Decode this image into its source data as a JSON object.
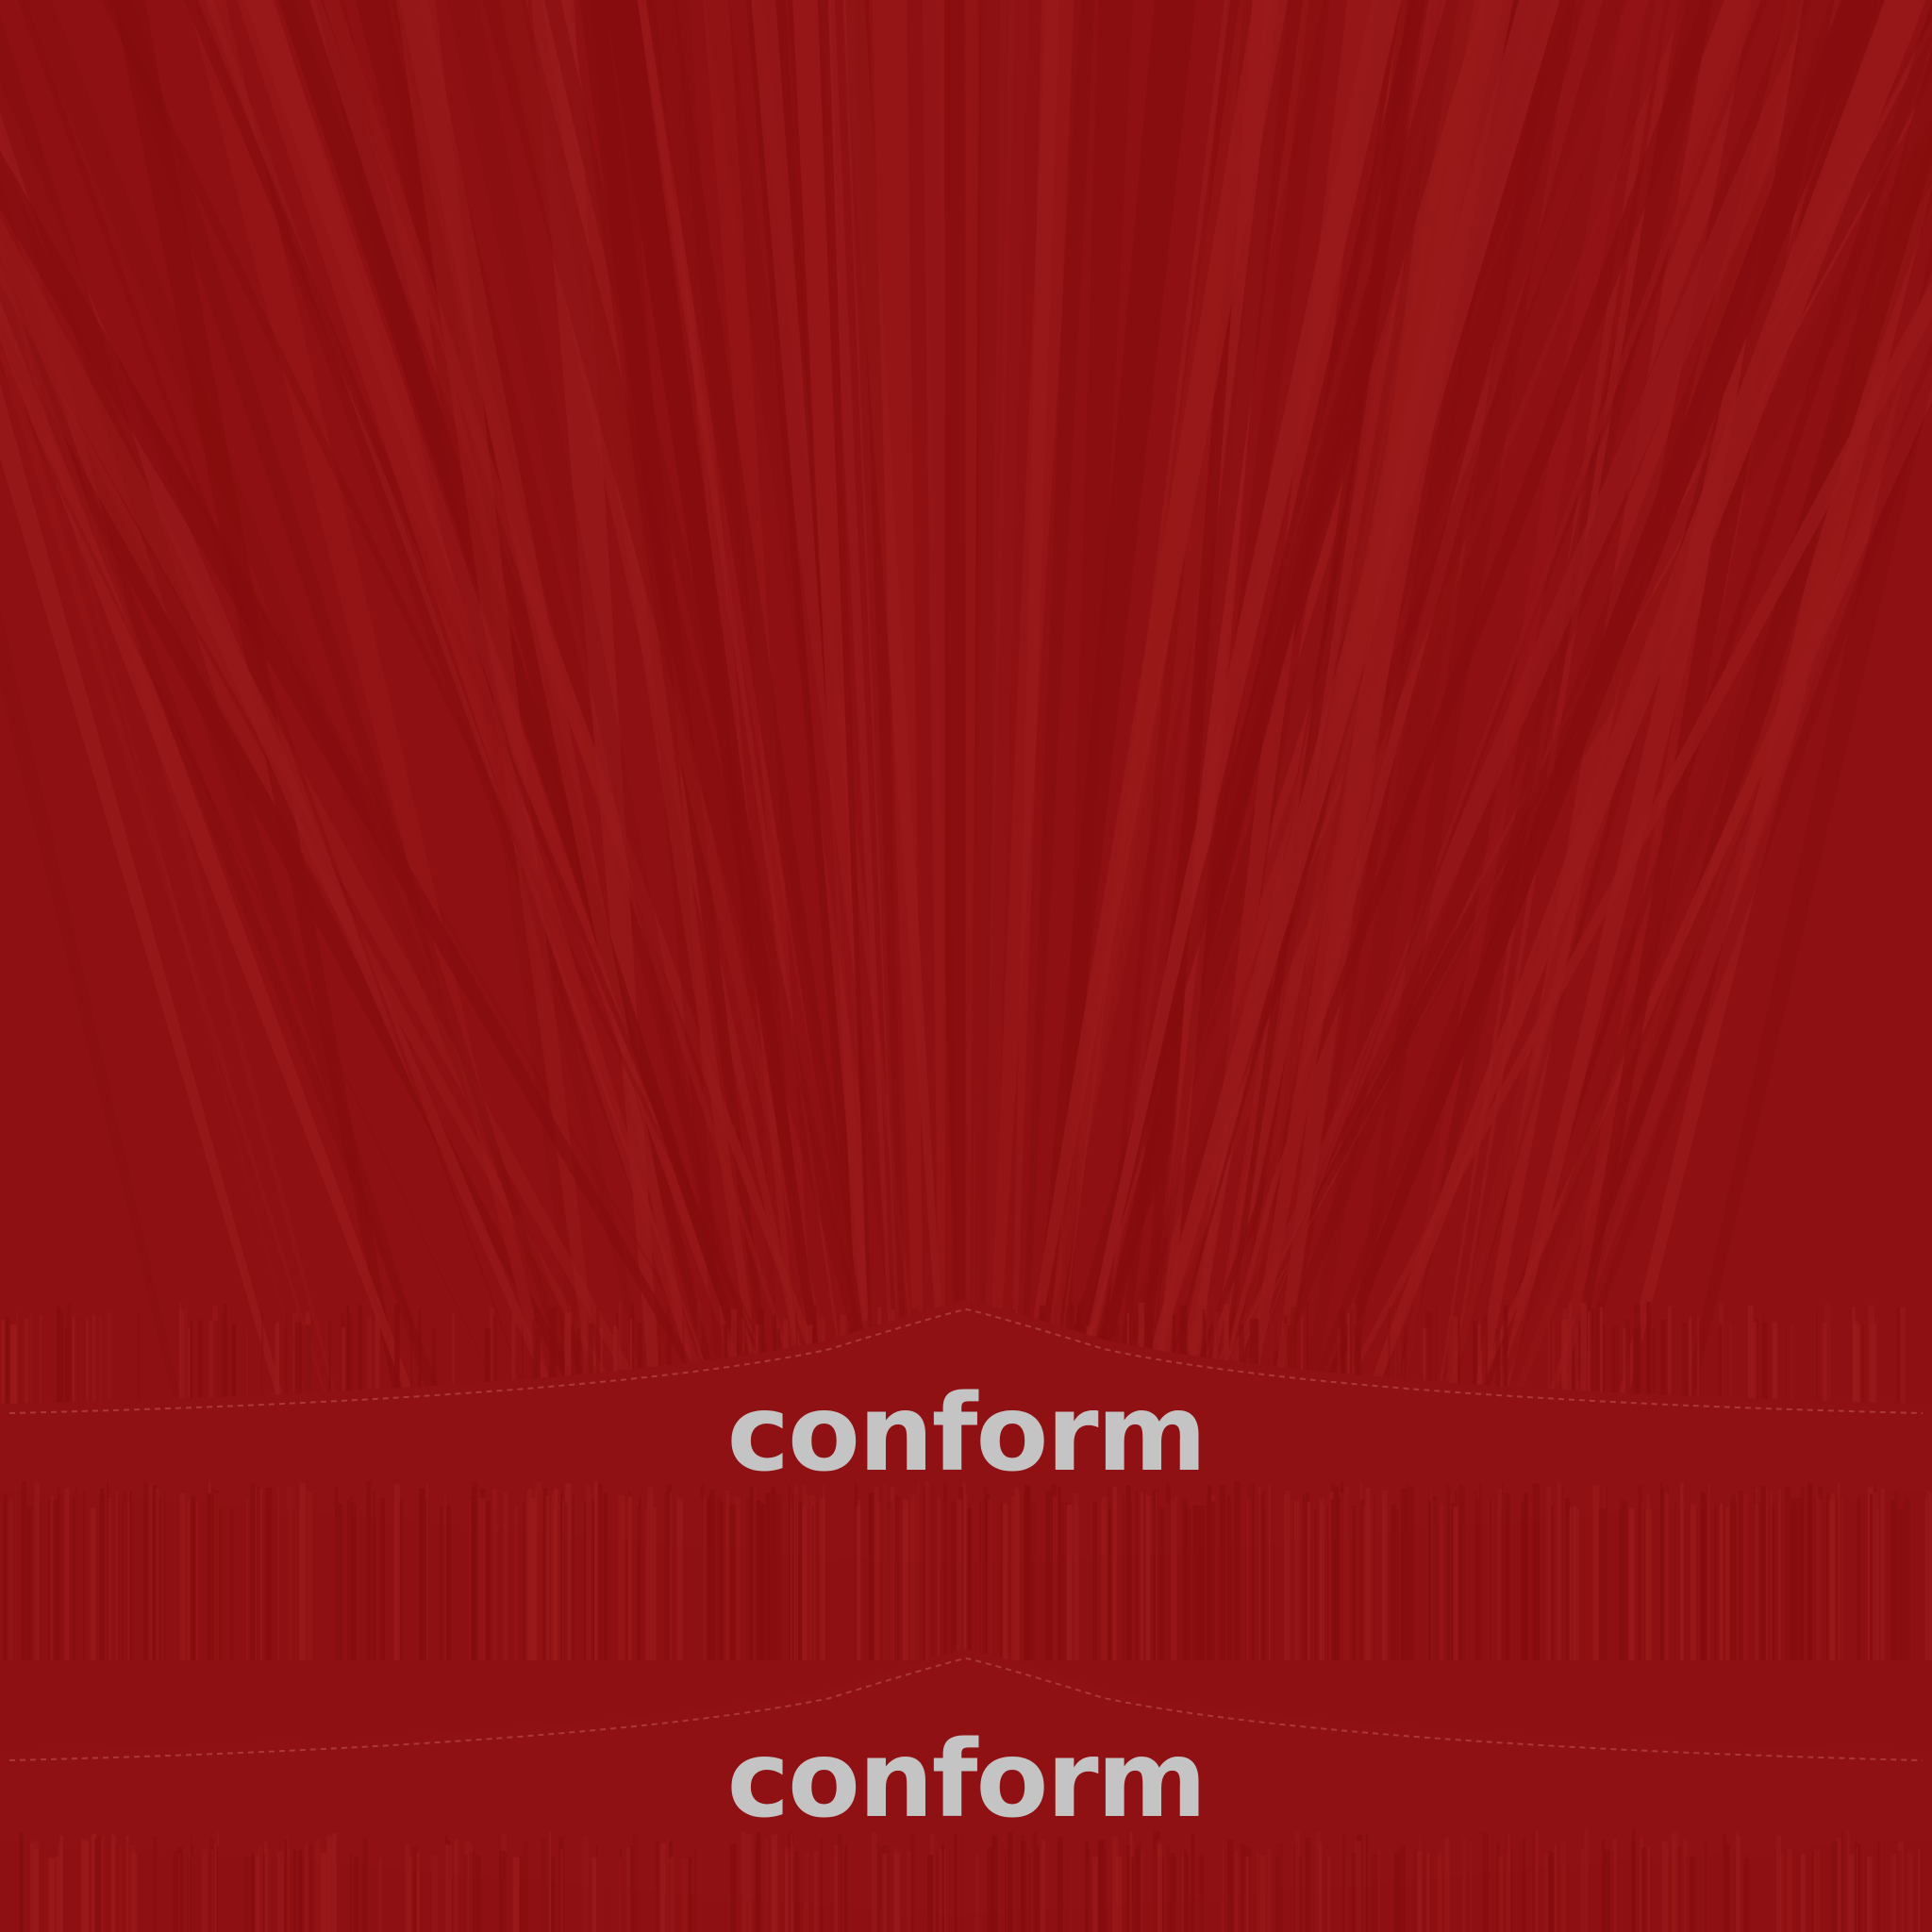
{
  "texture": {
    "background_color": "#8e1012",
    "stripe_light": "#9a1a1b",
    "stripe_dark": "#850c0e",
    "band_color": "#8f1113",
    "stitch_color": "#b8494a"
  },
  "bands": [
    {
      "logo_text": "conform",
      "logo_color": "#c4c4c4"
    },
    {
      "logo_text": "conform",
      "logo_color": "#c4c4c4"
    }
  ]
}
